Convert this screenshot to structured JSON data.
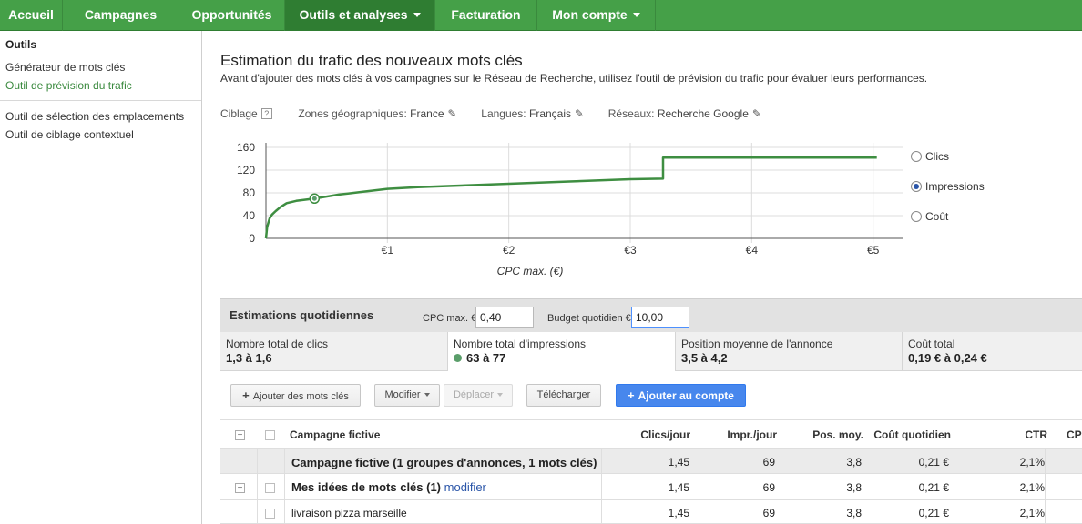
{
  "nav": {
    "tabs": [
      {
        "label": "Accueil"
      },
      {
        "label": "Campagnes"
      },
      {
        "label": "Opportunités"
      },
      {
        "label": "Outils et analyses"
      },
      {
        "label": "Facturation"
      },
      {
        "label": "Mon compte"
      }
    ],
    "accent": "#45a048"
  },
  "sidebar": {
    "title": "Outils",
    "items": [
      {
        "label": "Générateur de mots clés"
      },
      {
        "label": "Outil de prévision du trafic"
      },
      {
        "label": "Outil de sélection des emplacements"
      },
      {
        "label": "Outil de ciblage contextuel"
      }
    ]
  },
  "page": {
    "title": "Estimation du trafic des nouveaux mots clés",
    "description": "Avant d'ajouter des mots clés à vos campagnes sur le Réseau de Recherche, utilisez l'outil de prévision du trafic pour évaluer leurs performances."
  },
  "targeting": {
    "label": "Ciblage",
    "help": "?",
    "geo_label": "Zones géographiques:",
    "geo_value": "France",
    "lang_label": "Langues:",
    "lang_value": "Français",
    "net_label": "Réseaux:",
    "net_value": "Recherche Google"
  },
  "chart_data": {
    "type": "line",
    "xlabel": "CPC max. (€)",
    "ylabel": "",
    "xlim": [
      0,
      5.25
    ],
    "ylim": [
      0,
      160
    ],
    "xticks": [
      1,
      2,
      3,
      4,
      5
    ],
    "xtick_labels": [
      "€1",
      "€2",
      "€3",
      "€4",
      "€5"
    ],
    "yticks": [
      0,
      40,
      80,
      120,
      160
    ],
    "ytick_labels": [
      "0",
      "40",
      "80",
      "120",
      "160"
    ],
    "grid": true,
    "line_color": "#3e8e41",
    "series": [
      {
        "x": [
          0,
          0.01,
          0.03,
          0.05,
          0.08,
          0.12,
          0.17,
          0.25,
          0.4,
          0.6,
          0.8,
          1.0,
          1.25,
          1.5,
          1.75,
          2.0,
          2.25,
          2.5,
          2.75,
          3.0,
          3.27,
          3.27,
          4.0,
          5.03
        ],
        "y": [
          0,
          20,
          35,
          42,
          48,
          55,
          62,
          66,
          70,
          77,
          82,
          87,
          90,
          92,
          94,
          96,
          98,
          100,
          102,
          104,
          105,
          142,
          142,
          142
        ]
      }
    ],
    "marker": {
      "x": 0.4,
      "y": 70
    },
    "options": [
      {
        "label": "Clics",
        "selected": false
      },
      {
        "label": "Impressions",
        "selected": true
      },
      {
        "label": "Coût",
        "selected": false
      }
    ]
  },
  "estimates": {
    "title": "Estimations quotidiennes",
    "cpc_label": "CPC max. €",
    "cpc_value": "0,40",
    "budget_label": "Budget quotidien €",
    "budget_value": "10,00",
    "cells": [
      {
        "label": "Nombre total de clics",
        "value": "1,3 à 1,6"
      },
      {
        "label": "Nombre total d'impressions",
        "value": "63 à 77"
      },
      {
        "label": "Position moyenne de l'annonce",
        "value": "3,5 à 4,2"
      },
      {
        "label": "Coût total",
        "value": "0,19 € à 0,24 €"
      }
    ]
  },
  "toolbar": {
    "add_keywords": "Ajouter des mots clés",
    "modify": "Modifier",
    "move": "Déplacer",
    "download": "Télécharger",
    "add_account": "Ajouter au compte"
  },
  "table": {
    "headers": {
      "name": "Campagne fictive",
      "clicks": "Clics/jour",
      "impr": "Impr./jour",
      "pos": "Pos. moy.",
      "cost": "Coût quotidien",
      "ctr": "CTR",
      "cpc": "CPC"
    },
    "campaign": {
      "name": "Campagne fictive (1 groupes d'annonces, 1 mots clés)",
      "clicks": "1,45",
      "impr": "69",
      "pos": "3,8",
      "cost": "0,21 €",
      "ctr": "2,1%"
    },
    "group": {
      "name": "Mes idées de mots clés (1)",
      "edit": "modifier",
      "clicks": "1,45",
      "impr": "69",
      "pos": "3,8",
      "cost": "0,21 €",
      "ctr": "2,1%"
    },
    "keyword": {
      "name": "livraison pizza marseille",
      "clicks": "1,45",
      "impr": "69",
      "pos": "3,8",
      "cost": "0,21 €",
      "ctr": "2,1%"
    }
  }
}
